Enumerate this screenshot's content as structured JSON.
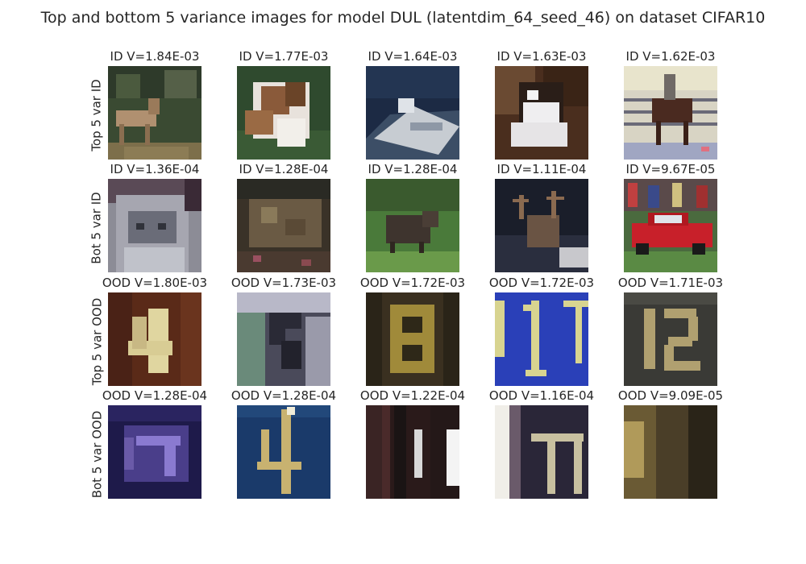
{
  "title": "Top and bottom 5 variance images for model DUL (latentdim_64_seed_46) on dataset CIFAR10",
  "rows": [
    {
      "label": "Top 5 var ID",
      "cells": [
        {
          "label": "ID V=1.84E-03"
        },
        {
          "label": "ID V=1.77E-03"
        },
        {
          "label": "ID V=1.64E-03"
        },
        {
          "label": "ID V=1.63E-03"
        },
        {
          "label": "ID V=1.62E-03"
        }
      ]
    },
    {
      "label": "Bot 5 var ID",
      "cells": [
        {
          "label": "ID V=1.36E-04"
        },
        {
          "label": "ID V=1.28E-04"
        },
        {
          "label": "ID V=1.28E-04"
        },
        {
          "label": "ID V=1.11E-04"
        },
        {
          "label": "ID V=9.67E-05"
        }
      ]
    },
    {
      "label": "Top 5 var OOD",
      "cells": [
        {
          "label": "OOD V=1.80E-03"
        },
        {
          "label": "OOD V=1.73E-03"
        },
        {
          "label": "OOD V=1.72E-03"
        },
        {
          "label": "OOD V=1.72E-03"
        },
        {
          "label": "OOD V=1.71E-03"
        }
      ]
    },
    {
      "label": "Bot 5 var OOD",
      "cells": [
        {
          "label": "OOD V=1.28E-04"
        },
        {
          "label": "OOD V=1.28E-04"
        },
        {
          "label": "OOD V=1.22E-04"
        },
        {
          "label": "OOD V=1.16E-04"
        },
        {
          "label": "OOD V=9.09E-05"
        }
      ]
    }
  ]
}
